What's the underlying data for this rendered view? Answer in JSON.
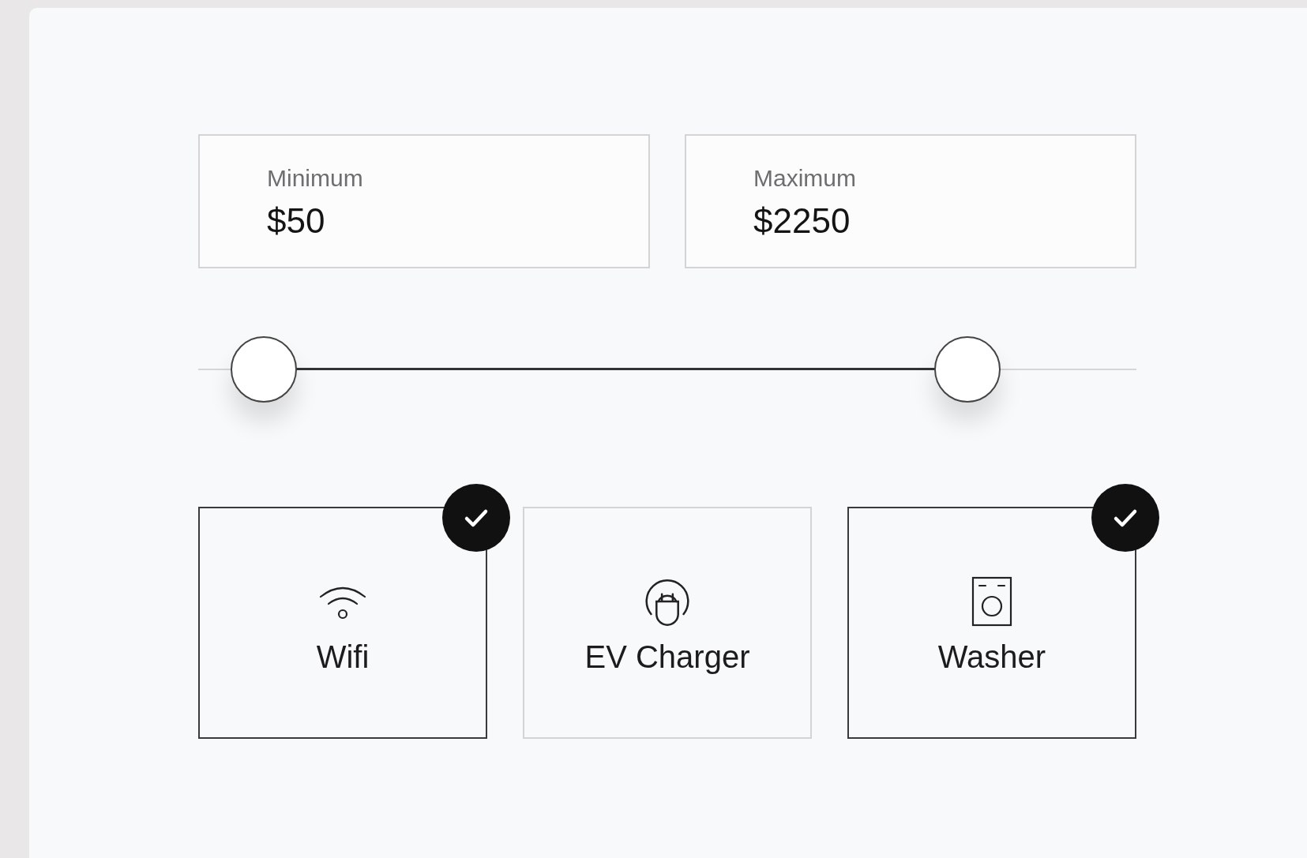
{
  "price_fields": [
    {
      "label": "Minimum",
      "value": "$50"
    },
    {
      "label": "Maximum",
      "value": "$2250"
    }
  ],
  "price_slider": {
    "thumbs": [
      {
        "level": 0.07
      },
      {
        "level": 0.82
      }
    ]
  },
  "amenities": [
    {
      "label": "Wifi",
      "kind": "wifi",
      "selected": true
    },
    {
      "label": "EV Charger",
      "kind": "charger",
      "selected": false
    },
    {
      "label": "Washer",
      "kind": "washer",
      "selected": true
    }
  ]
}
